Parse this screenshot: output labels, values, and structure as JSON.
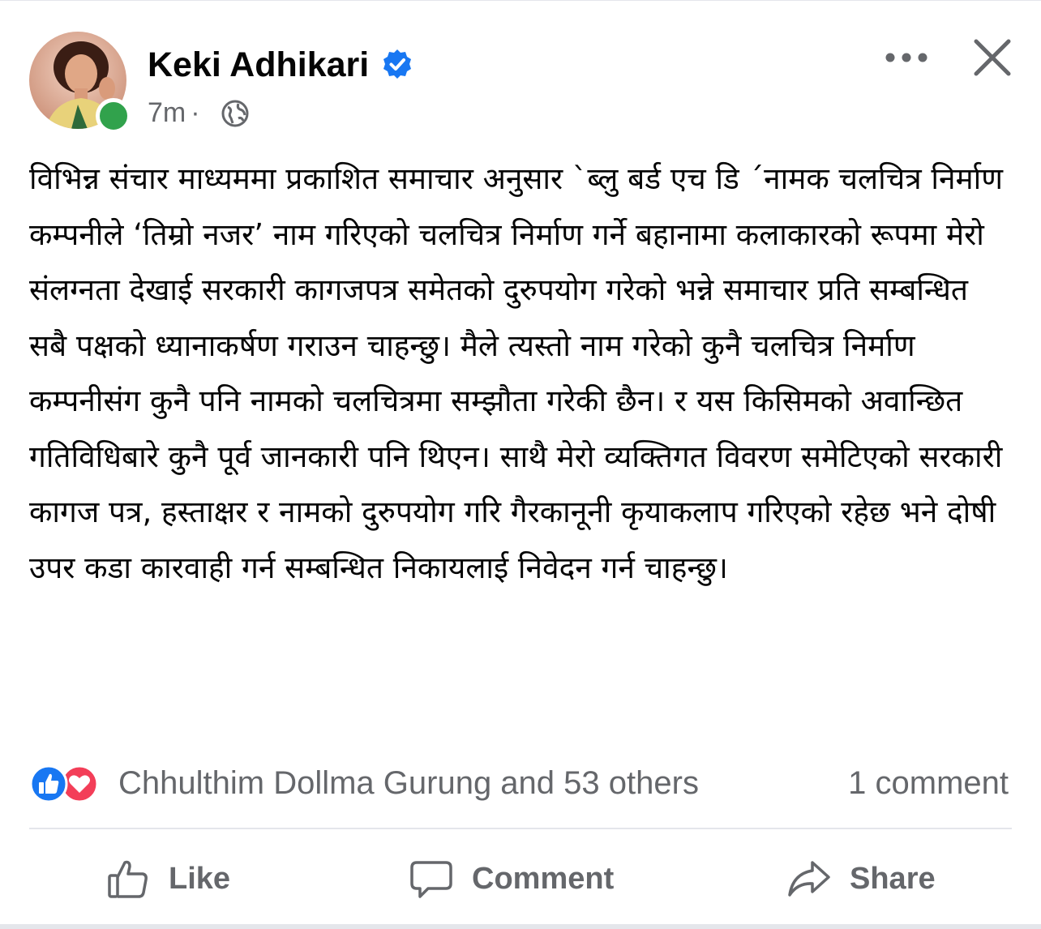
{
  "post": {
    "author": {
      "name": "Keki Adhikari",
      "verified": true,
      "online": true,
      "avatar_icon": "profile-photo"
    },
    "timestamp": "7m",
    "separator": "·",
    "audience_icon": "globe-icon",
    "text": "विभिन्न संचार माध्यममा प्रकाशित समाचार अनुसार `ब्लु बर्ड एच डि ´नामक चलचित्र निर्माण कम्पनीले ‘तिम्रो नजर’ नाम गरिएको चलचित्र निर्माण गर्ने बहानामा कलाकारको रूपमा मेरो संलग्नता देखाई सरकारी कागजपत्र समेतको दुरुपयोग गरेको भन्ने समाचार प्रति सम्बन्धित सबै पक्षको ध्यानाकर्षण गराउन चाहन्छु। मैले त्यस्तो नाम गरेको कुनै चलचित्र निर्माण कम्पनीसंग कुनै पनि नामको चलचित्रमा सम्झौता गरेकी छैन। र यस किसिमको अवान्छित गतिविधिबारे कुनै पूर्व जानकारी पनि थिएन। साथै मेरो व्यक्तिगत विवरण समेटिएको सरकारी कागज पत्र, हस्ताक्षर र नामको दुरुपयोग गरि गैरकानूनी कृयाकलाप गरिएको रहेछ भने दोषी उपर कडा कारवाही गर्न सम्बन्धित निकायलाई निवेदन गर्न चाहन्छु।"
  },
  "reactions": {
    "types": [
      "like",
      "love"
    ],
    "summary": "Chhulthim Dollma Gurung and 53 others",
    "comments": "1 comment"
  },
  "actions": {
    "like": "Like",
    "comment": "Comment",
    "share": "Share"
  },
  "colors": {
    "text_primary": "#050505",
    "text_secondary": "#65676b",
    "facebook_blue": "#1877f2",
    "love_red": "#f33e58",
    "online_green": "#31a24c",
    "divider": "#e4e6eb"
  }
}
